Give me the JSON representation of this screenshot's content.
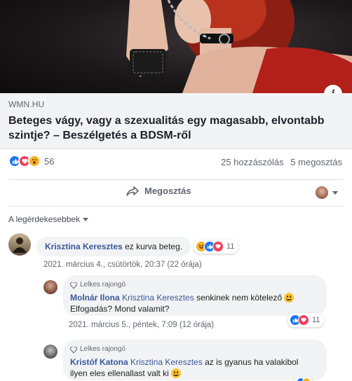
{
  "link_preview": {
    "domain": "WMN.HU",
    "title": "Beteges vágy, vagy a szexualitás egy magasabb, elvontabb szintje? – Beszélgetés a BDSM-ről",
    "info_icon": "info-icon"
  },
  "stats": {
    "reaction_types": [
      "like",
      "love",
      "wow"
    ],
    "reaction_count": "56",
    "comments": "25 hozzászólás",
    "shares": "5 megosztás"
  },
  "actions": {
    "share_label": "Megosztás",
    "share_icon": "share-arrow-icon"
  },
  "sort": {
    "label": "A legérdekesebbek"
  },
  "comments": [
    {
      "author": "Krisztina Keresztes",
      "text": "ez kurva beteg.",
      "reaction_count": "11",
      "timestamp": "2021. március 4., csütörtök, 20:37 (22 órája)"
    }
  ],
  "replies": [
    {
      "badge": "Lelkes rajongó",
      "author": "Molnár Ilona",
      "mention": "Krisztina Keresztes",
      "text": "senkinek nem kötelező",
      "text2": "Elfogadás? Mond valamit?",
      "reaction_count": "11",
      "timestamp": "2021. március 5., péntek, 7:09 (12 órája)"
    },
    {
      "badge": "Lelkes rajongó",
      "author": "Kristóf Katona",
      "mention": "Krisztina Keresztes",
      "text": "az is gyanus ha valakibol",
      "text2": "ilyen eles ellenallast valt ki"
    }
  ],
  "colors": {
    "link_blue": "#385898",
    "like_blue": "#1877f2",
    "love_red": "#f33e58",
    "wow_yellow": "#f7b125",
    "bubble_bg": "#f2f3f5"
  }
}
